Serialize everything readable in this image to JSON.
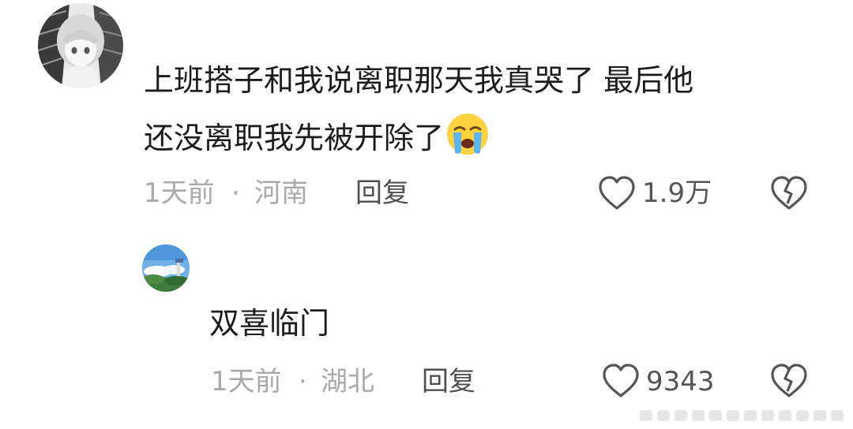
{
  "main_comment": {
    "text_line1": "上班搭子和我说离职那天我真哭了 最后他",
    "text_line2": "还没离职我先被开除了",
    "emoji": "crying-face-icon",
    "time": "1天前",
    "separator": "·",
    "location": "河南",
    "reply_label": "回复",
    "like_count": "1.9万"
  },
  "reply_comment": {
    "text": "双喜临门",
    "time": "1天前",
    "separator": "·",
    "location": "湖北",
    "reply_label": "回复",
    "like_count": "9343"
  },
  "colors": {
    "text": "#1c1c1c",
    "meta": "#a9a9a9",
    "icon": "#555555",
    "emoji_face": "#ffd23f",
    "emoji_tears": "#5bb4f0"
  }
}
